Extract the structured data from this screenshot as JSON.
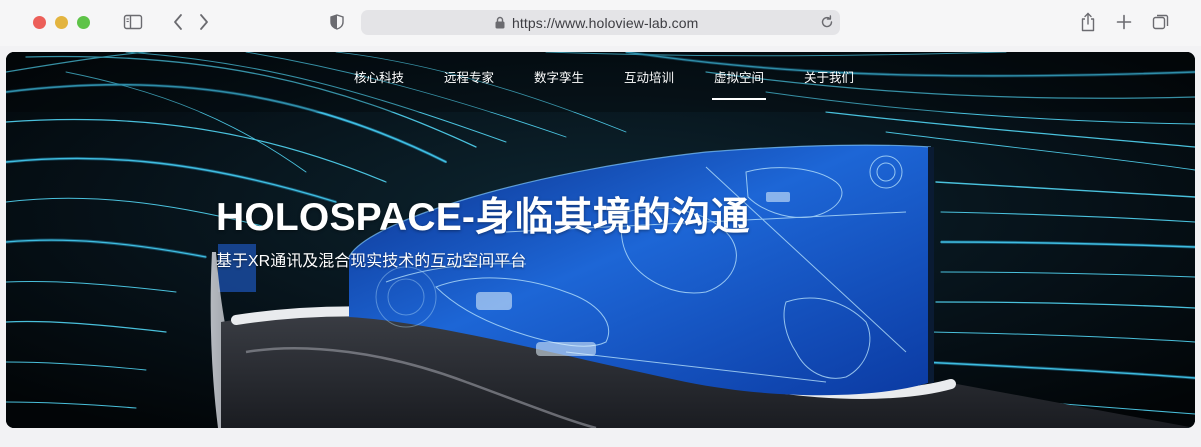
{
  "browser": {
    "url": "https://www.holoview-lab.com"
  },
  "nav": {
    "items": [
      {
        "label": "核心科技",
        "active": false
      },
      {
        "label": "远程专家",
        "active": false
      },
      {
        "label": "数字孪生",
        "active": false
      },
      {
        "label": "互动培训",
        "active": false
      },
      {
        "label": "虚拟空间",
        "active": true
      },
      {
        "label": "关于我们",
        "active": false
      }
    ]
  },
  "hero": {
    "title": "HOLOSPACE-身临其境的沟通",
    "subtitle": "基于XR通讯及混合现实技术的互动空间平台"
  },
  "colors": {
    "close": "#ec5f59",
    "minimize": "#e3b43f",
    "zoom": "#5ec348",
    "light_trail": "#56e0ff",
    "screen_blue": "#1f6fd8"
  }
}
